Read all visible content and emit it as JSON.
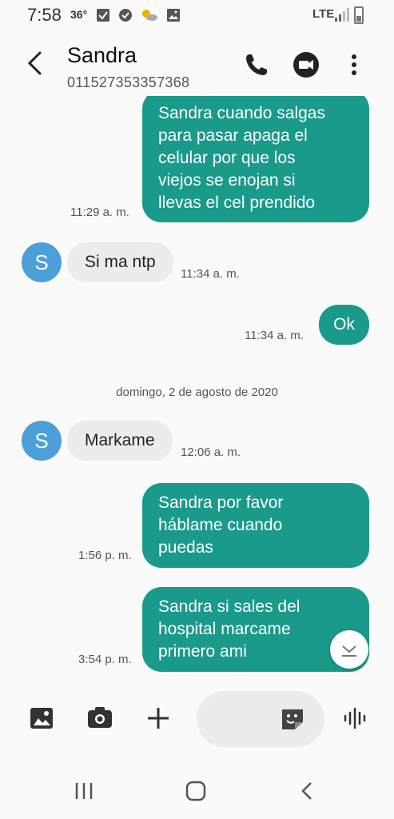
{
  "status_bar": {
    "time": "7:58",
    "temperature": "36°",
    "network": "LTE",
    "icons": [
      "checkbox-notification-icon",
      "check-circle-icon",
      "weather-icon",
      "image-icon",
      "signal-icon",
      "battery-icon"
    ]
  },
  "header": {
    "contact_name": "Sandra",
    "contact_number": "011527353357368",
    "icons": [
      "back-arrow-icon",
      "phone-icon",
      "video-call-icon",
      "more-vert-icon"
    ]
  },
  "thread": {
    "messages": [
      {
        "direction": "sent",
        "text_lines": [
          "Sandra cuando salgas",
          "para pasar apaga el",
          "celular por que los",
          "viejos se enojan si",
          "llevas el cel prendido"
        ],
        "time": "11:29 a. m."
      },
      {
        "direction": "received",
        "avatar_letter": "S",
        "text": "Si ma ntp",
        "time": "11:34 a. m."
      },
      {
        "direction": "sent",
        "text_lines": [
          "Ok"
        ],
        "time": "11:34 a. m."
      },
      {
        "direction": "received",
        "avatar_letter": "S",
        "text": "Markame",
        "time": "12:06 a. m."
      },
      {
        "direction": "sent",
        "text_lines": [
          "Sandra por favor",
          "háblame cuando",
          "puedas"
        ],
        "time": "1:56 p. m."
      },
      {
        "direction": "sent",
        "text_lines": [
          "Sandra si sales del",
          "hospital  marcame",
          "primero ami"
        ],
        "time": "3:54 p. m."
      }
    ],
    "date_separator": "domingo, 2 de agosto de 2020"
  },
  "composer": {
    "input_placeholder": "",
    "icons": [
      "gallery-icon",
      "camera-icon",
      "plus-icon",
      "sticker-icon",
      "voice-icon"
    ]
  },
  "nav_bar": {
    "icons": [
      "recents-icon",
      "home-icon",
      "back-icon"
    ]
  },
  "colors": {
    "sent_bubble": "#1a9a8a",
    "received_bubble": "#ececec",
    "avatar": "#4d9fd8",
    "background": "#fafafa"
  }
}
